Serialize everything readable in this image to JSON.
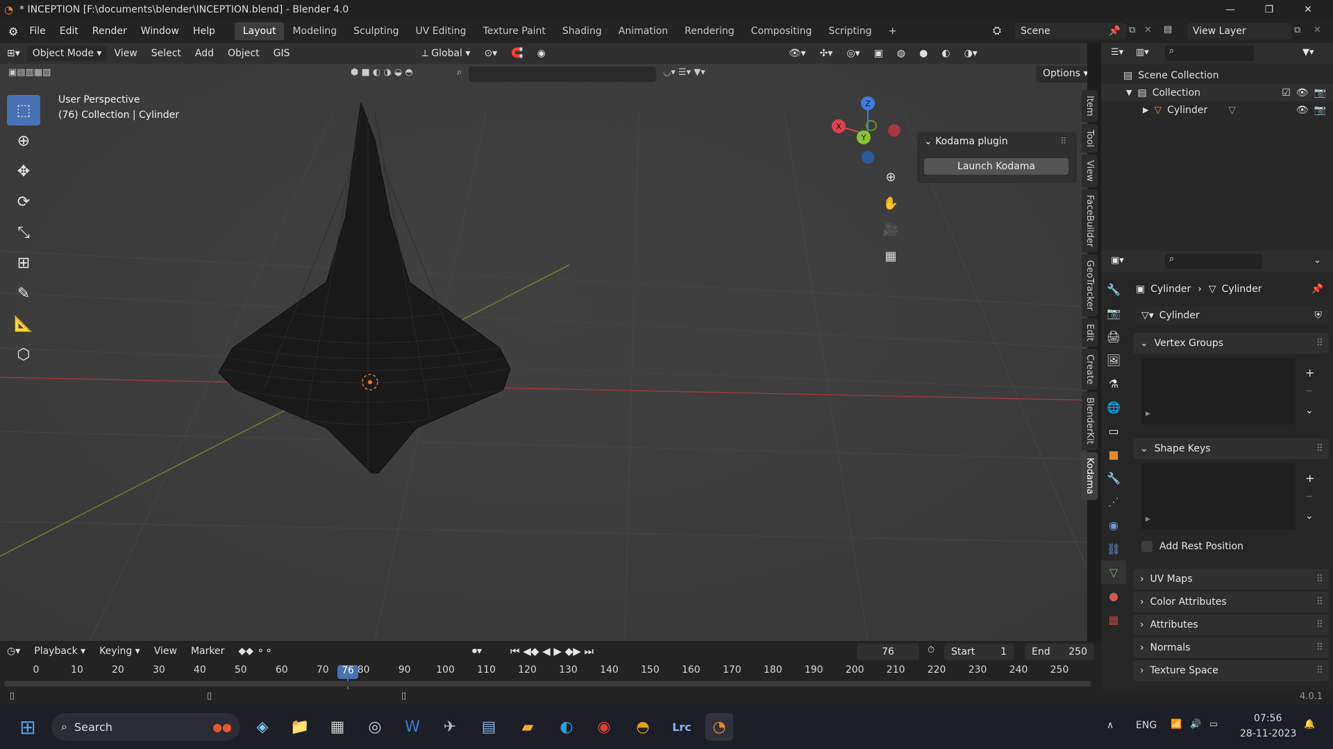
{
  "window": {
    "title": "* INCEPTION [F:\\documents\\blender\\INCEPTION.blend] - Blender 4.0",
    "minimize": "—",
    "maximize": "❐",
    "close": "✕"
  },
  "menu": {
    "items": [
      "File",
      "Edit",
      "Render",
      "Window",
      "Help"
    ],
    "workspaces": [
      "Layout",
      "Modeling",
      "Sculpting",
      "UV Editing",
      "Texture Paint",
      "Shading",
      "Animation",
      "Rendering",
      "Compositing",
      "Scripting"
    ],
    "active_workspace": "Layout",
    "add_workspace": "+",
    "scene_label": "Scene",
    "view_layer_label": "View Layer"
  },
  "viewport": {
    "mode": "Object Mode",
    "menus": [
      "View",
      "Select",
      "Add",
      "Object",
      "GIS"
    ],
    "transform_orientation": "Global",
    "options_label": "Options",
    "perspective_label": "User Perspective",
    "collection_label": "(76) Collection | Cylinder",
    "side_tabs": [
      "Item",
      "Tool",
      "View",
      "FaceBuilder",
      "GeoTracker",
      "Edit",
      "Create",
      "BlenderKit",
      "Kodama"
    ],
    "active_side_tab": "Kodama",
    "kodama_panel_title": "Kodama plugin",
    "kodama_button": "Launch Kodama",
    "gizmo_axes": {
      "x": "X",
      "y": "Y",
      "z": "Z"
    },
    "colors": {
      "x_axis": "#d9434e",
      "y_axis": "#8bc232",
      "z_axis": "#3c7ee0"
    }
  },
  "timeline": {
    "menus": [
      "Playback",
      "Keying",
      "View",
      "Marker"
    ],
    "current_frame": "76",
    "start_label": "Start",
    "start_value": "1",
    "end_label": "End",
    "end_value": "250",
    "ticks": [
      "0",
      "10",
      "20",
      "30",
      "40",
      "50",
      "60",
      "70",
      "80",
      "90",
      "100",
      "110",
      "120",
      "130",
      "140",
      "150",
      "160",
      "170",
      "180",
      "190",
      "200",
      "210",
      "220",
      "230",
      "240",
      "250"
    ],
    "playhead_label": "76"
  },
  "outliner": {
    "scene_collection": "Scene Collection",
    "collection": "Collection",
    "object": "Cylinder"
  },
  "properties": {
    "breadcrumb_object": "Cylinder",
    "breadcrumb_data": "Cylinder",
    "mesh_name": "Cylinder",
    "sections": [
      "Vertex Groups",
      "Shape Keys",
      "UV Maps",
      "Color Attributes",
      "Attributes",
      "Normals",
      "Texture Space"
    ],
    "add_rest_position": "Add Rest Position"
  },
  "status": {
    "version": "4.0.1"
  },
  "taskbar": {
    "search_label": "Search",
    "lang": "ENG",
    "time": "07:56",
    "date": "28-11-2023"
  }
}
